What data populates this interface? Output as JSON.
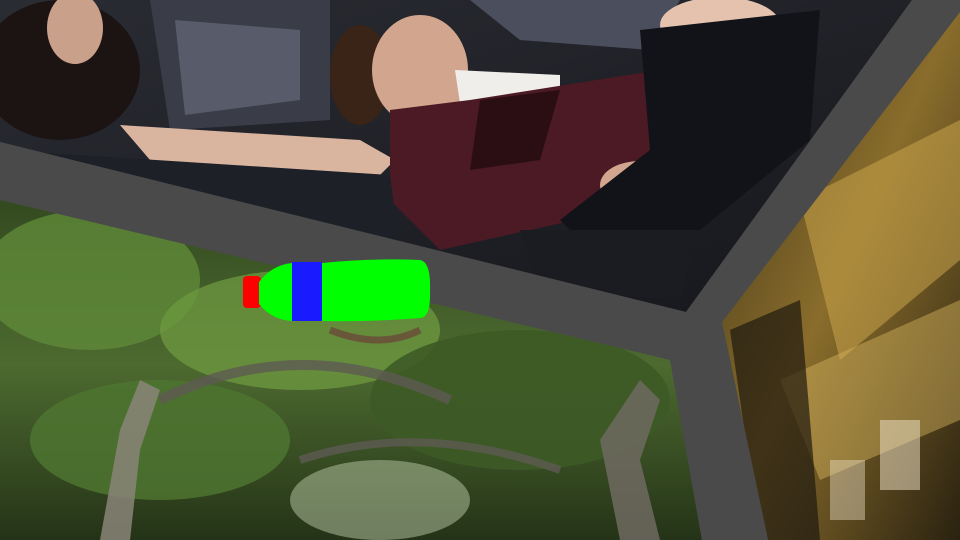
{
  "scene": {
    "frame_color": "#4a4a4a",
    "panels": [
      {
        "name": "ceiling-panel",
        "content": "photo-couple-reclining",
        "palette": {
          "bg": "#2a2c33",
          "dark": "#15161b",
          "skin": "#d9b5a0",
          "suit": "#4c1a24",
          "shirt": "#efeeea",
          "hair": "#2b1c16"
        }
      },
      {
        "name": "back-wall-panel",
        "content": "photo-tree-canopy",
        "palette": {
          "bg": "#3e5a2c",
          "light": "#8fb35a",
          "dark": "#1d2a16",
          "trunk": "#6f6a60"
        }
      },
      {
        "name": "right-wall-panel",
        "content": "photo-brick-building",
        "palette": {
          "bg": "#5a4a22",
          "light": "#c9a44a",
          "dark": "#1f1a0f"
        }
      }
    ],
    "object": {
      "name": "bottle",
      "colors": {
        "cap": "#ff0000",
        "label": "#1a1aff",
        "body": "#00ff00"
      }
    }
  }
}
